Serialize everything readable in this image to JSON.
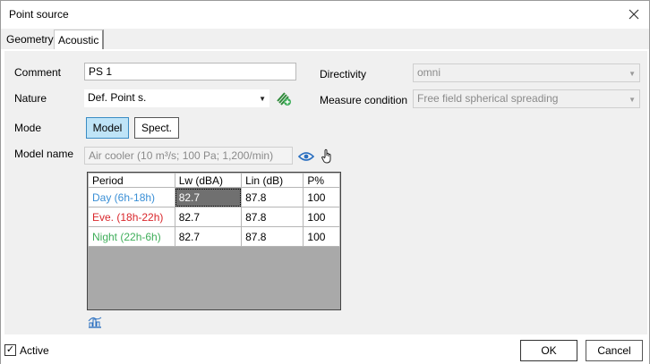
{
  "window": {
    "title": "Point source"
  },
  "tabs": [
    {
      "label": "Geometry",
      "active": false
    },
    {
      "label": "Acoustic",
      "active": true
    }
  ],
  "form": {
    "comment_label": "Comment",
    "comment_value": "PS 1",
    "nature_label": "Nature",
    "nature_value": "Def. Point s.",
    "mode_label": "Mode",
    "mode_model": "Model",
    "mode_spect": "Spect.",
    "model_name_label": "Model name",
    "model_name_value": "Air cooler (10 m³/s; 100 Pa; 1,200/min)",
    "directivity_label": "Directivity",
    "directivity_value": "omni",
    "measure_label": "Measure condition",
    "measure_value": "Free field spherical spreading"
  },
  "grid": {
    "headers": [
      "Period",
      "Lw (dBA)",
      "Lin (dB)",
      "P%"
    ],
    "rows": [
      {
        "period": "Day (6h-18h)",
        "lw": "82.7",
        "lin": "87.8",
        "p": "100",
        "color": "#3a8fd6"
      },
      {
        "period": "Eve. (18h-22h)",
        "lw": "82.7",
        "lin": "87.8",
        "p": "100",
        "color": "#d9262b"
      },
      {
        "period": "Night (22h-6h)",
        "lw": "82.7",
        "lin": "87.8",
        "p": "100",
        "color": "#3fae5a"
      }
    ]
  },
  "footer": {
    "active_label": "Active",
    "active_checked": true,
    "ok_label": "OK",
    "cancel_label": "Cancel"
  },
  "icons": {
    "close": "close-icon",
    "nature_add": "add-layers-icon",
    "view": "eye-icon",
    "pointer": "hand-pointer-icon",
    "chart": "spectrum-chart-icon"
  }
}
